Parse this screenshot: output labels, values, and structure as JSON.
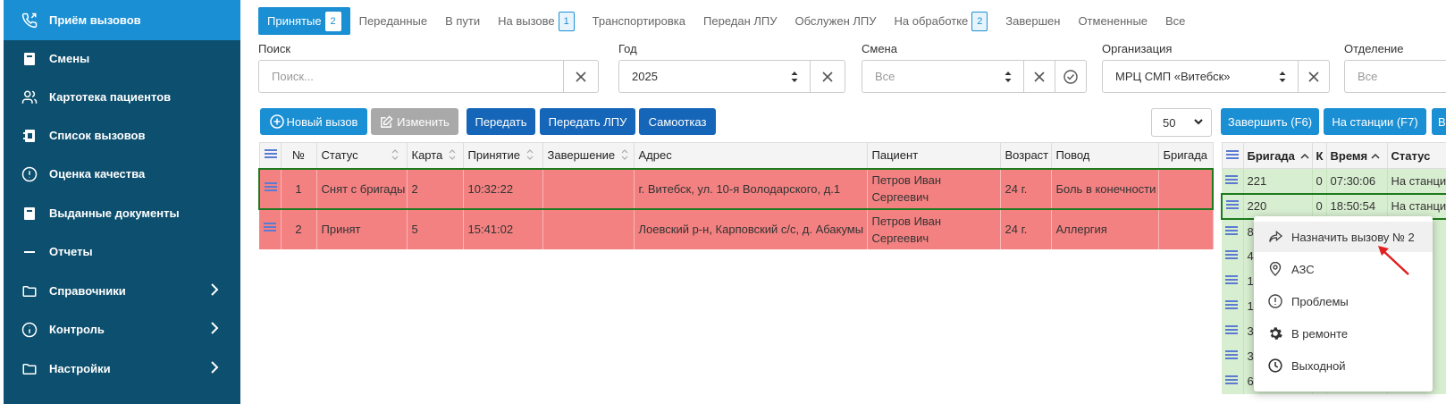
{
  "sidebar": {
    "items": [
      {
        "label": "Приём вызовов",
        "icon": "phone-forward-icon",
        "active": true
      },
      {
        "label": "Смены",
        "icon": "book-icon"
      },
      {
        "label": "Картотека пациентов",
        "icon": "users-icon"
      },
      {
        "label": "Список вызовов",
        "icon": "list-book-icon"
      },
      {
        "label": "Оценка качества",
        "icon": "alert-circle-icon"
      },
      {
        "label": "Выданные документы",
        "icon": "book-icon"
      },
      {
        "label": "Отчеты",
        "icon": "minus-icon"
      },
      {
        "label": "Справочники",
        "icon": "folder-icon",
        "has_arrow": true
      },
      {
        "label": "Контроль",
        "icon": "info-circle-icon",
        "has_arrow": true
      },
      {
        "label": "Настройки",
        "icon": "folder-icon",
        "has_arrow": true
      }
    ]
  },
  "tabs": [
    {
      "label": "Принятые",
      "badge": "2",
      "active": true
    },
    {
      "label": "Переданные"
    },
    {
      "label": "В пути"
    },
    {
      "label": "На вызове",
      "badge": "1"
    },
    {
      "label": "Транспортировка"
    },
    {
      "label": "Передан ЛПУ"
    },
    {
      "label": "Обслужен ЛПУ"
    },
    {
      "label": "На обработке",
      "badge": "2"
    },
    {
      "label": "Завершен"
    },
    {
      "label": "Отмененные"
    },
    {
      "label": "Все"
    }
  ],
  "filters": {
    "search_label": "Поиск",
    "search_placeholder": "Поиск...",
    "year_label": "Год",
    "year_value": "2025",
    "shift_label": "Смена",
    "shift_value": "Все",
    "org_label": "Организация",
    "org_value": "МРЦ СМП «Витебск»",
    "dept_label": "Отделение",
    "dept_value": "Все"
  },
  "toolbar": {
    "new_call": "Новый вызов",
    "edit": "Изменить",
    "transfer": "Передать",
    "transfer_lpu": "Передать ЛПУ",
    "self_refuse": "Самоотказ",
    "page_size": "50"
  },
  "main_table": {
    "columns": [
      "№",
      "Статус",
      "Карта",
      "Принятие",
      "Завершение",
      "Адрес",
      "Пациент",
      "Возраст",
      "Повод",
      "Бригада"
    ],
    "rows": [
      {
        "num": "1",
        "status": "Снят с бригады",
        "card": "2",
        "accepted": "10:32:22",
        "finished": "",
        "address": "г. Витебск, ул. 10-я Володарского, д.1",
        "patient": "Петров Иван Сергеевич",
        "age": "24 г.",
        "reason": "Боль в конечности",
        "brigade": ""
      },
      {
        "num": "2",
        "status": "Принят",
        "card": "5",
        "accepted": "15:41:02",
        "finished": "",
        "address": "Лоевский р-н, Карповский с/с, д. Абакумы",
        "patient": "Петров Иван Сергеевич",
        "age": "24 г.",
        "reason": "Аллергия",
        "brigade": ""
      }
    ]
  },
  "right_panel": {
    "finish_btn": "Завершить (F6)",
    "station_btn": "На станции (F7)",
    "extra_btn": "В",
    "columns": [
      "Бригада",
      "К",
      "Время",
      "Статус"
    ],
    "rows": [
      {
        "brigade": "221",
        "k": "0",
        "time": "07:30:06",
        "status": "На станции"
      },
      {
        "brigade": "220",
        "k": "0",
        "time": "18:50:54",
        "status": "На станции"
      },
      {
        "brigade": "8",
        "k": "",
        "time": "",
        "status": ""
      },
      {
        "brigade": "4",
        "k": "",
        "time": "",
        "status": ""
      },
      {
        "brigade": "1",
        "k": "",
        "time": "",
        "status": ""
      },
      {
        "brigade": "1",
        "k": "",
        "time": "",
        "status": ""
      },
      {
        "brigade": "3",
        "k": "",
        "time": "",
        "status": ""
      },
      {
        "brigade": "3",
        "k": "",
        "time": "",
        "status": ""
      },
      {
        "brigade": "6",
        "k": "",
        "time": "",
        "status": ""
      }
    ]
  },
  "context_menu": {
    "items": [
      {
        "label": "Назначить вызову № 2",
        "icon": "share-arrow-icon"
      },
      {
        "label": "АЗС",
        "icon": "map-pin-icon"
      },
      {
        "label": "Проблемы",
        "icon": "alert-circle-icon"
      },
      {
        "label": "В ремонте",
        "icon": "gear-icon"
      },
      {
        "label": "Выходной",
        "icon": "clock-icon"
      }
    ]
  }
}
